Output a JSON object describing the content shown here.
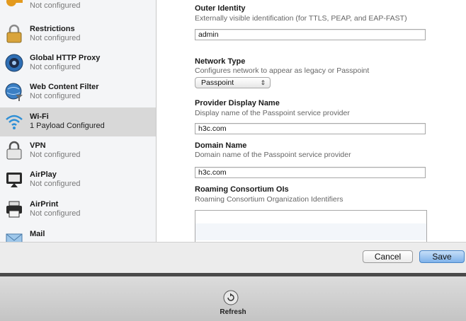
{
  "sidebar": {
    "items": [
      {
        "title": "",
        "sub": "Not configured",
        "icon": "key-icon"
      },
      {
        "title": "Restrictions",
        "sub": "Not configured",
        "icon": "lock-restrictions-icon"
      },
      {
        "title": "Global HTTP Proxy",
        "sub": "Not configured",
        "icon": "globe-proxy-icon"
      },
      {
        "title": "Web Content Filter",
        "sub": "Not configured",
        "icon": "globe-filter-icon"
      },
      {
        "title": "Wi-Fi",
        "sub": "1 Payload Configured",
        "icon": "wifi-icon"
      },
      {
        "title": "VPN",
        "sub": "Not configured",
        "icon": "vpn-lock-icon"
      },
      {
        "title": "AirPlay",
        "sub": "Not configured",
        "icon": "airplay-icon"
      },
      {
        "title": "AirPrint",
        "sub": "Not configured",
        "icon": "printer-icon"
      },
      {
        "title": "Mail",
        "sub": "",
        "icon": "mail-icon"
      }
    ]
  },
  "form": {
    "outer_identity": {
      "label": "Outer Identity",
      "desc": "Externally visible identification (for TTLS, PEAP, and EAP-FAST)",
      "value": "admin"
    },
    "network_type": {
      "label": "Network Type",
      "desc": "Configures network to appear as legacy or Passpoint",
      "value": "Passpoint"
    },
    "provider_display_name": {
      "label": "Provider Display Name",
      "desc": "Display name of the Passpoint service provider",
      "value": "h3c.com"
    },
    "domain_name": {
      "label": "Domain Name",
      "desc": "Domain name of the Passpoint service provider",
      "value": "h3c.com"
    },
    "roaming": {
      "label": "Roaming Consortium OIs",
      "desc": "Roaming Consortium Organization Identifiers"
    }
  },
  "footer": {
    "cancel": "Cancel",
    "save": "Save"
  },
  "toolbar": {
    "refresh": "Refresh"
  }
}
